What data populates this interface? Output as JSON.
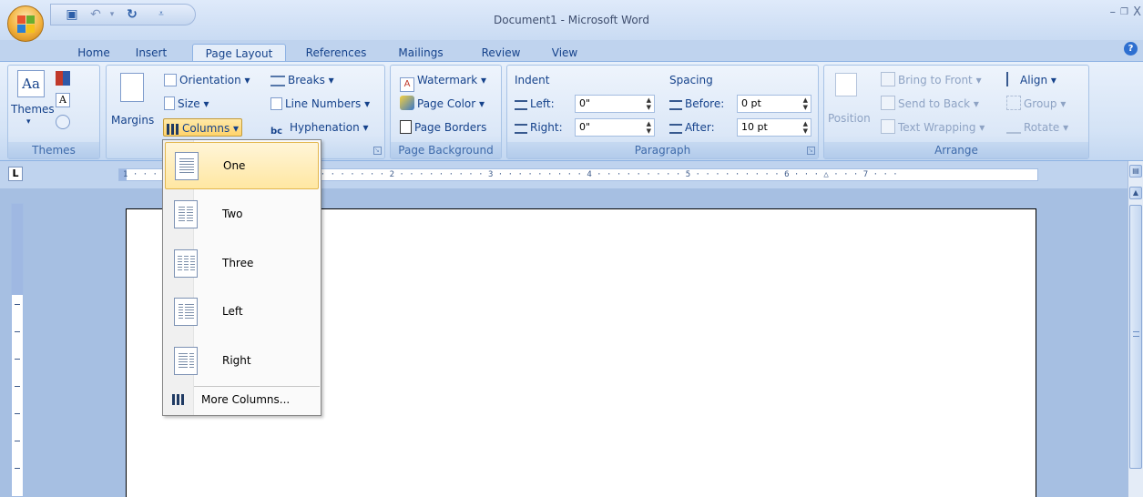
{
  "window": {
    "title": "Document1 - Microsoft Word",
    "controls": {
      "minimize": "–",
      "restore": "❐",
      "close": "X"
    }
  },
  "tabs": [
    {
      "label": "Home",
      "active": false
    },
    {
      "label": "Insert",
      "active": false
    },
    {
      "label": "Page Layout",
      "active": true
    },
    {
      "label": "References",
      "active": false
    },
    {
      "label": "Mailings",
      "active": false
    },
    {
      "label": "Review",
      "active": false
    },
    {
      "label": "View",
      "active": false
    }
  ],
  "ribbon": {
    "themes": {
      "group_label": "Themes",
      "themes_btn": "Themes"
    },
    "page_setup": {
      "margins": "Margins",
      "orientation": "Orientation ▾",
      "size": "Size ▾",
      "columns": "Columns ▾",
      "breaks": "Breaks ▾",
      "line_numbers": "Line Numbers ▾",
      "hyphenation": "Hyphenation ▾"
    },
    "page_background": {
      "group_label": "Page Background",
      "watermark": "Watermark ▾",
      "page_color": "Page Color ▾",
      "page_borders": "Page Borders"
    },
    "paragraph": {
      "group_label": "Paragraph",
      "indent_heading": "Indent",
      "spacing_heading": "Spacing",
      "left_label": "Left:",
      "left_value": "0\"",
      "right_label": "Right:",
      "right_value": "0\"",
      "before_label": "Before:",
      "before_value": "0 pt",
      "after_label": "After:",
      "after_value": "10 pt"
    },
    "arrange": {
      "group_label": "Arrange",
      "position": "Position",
      "bring_to_front": "Bring to Front ▾",
      "send_to_back": "Send to Back ▾",
      "text_wrapping": "Text Wrapping ▾",
      "align": "Align ▾",
      "group": "Group ▾",
      "rotate": "Rotate ▾"
    }
  },
  "ruler": {
    "ticks": "1 · · ·                         · 1 · · · · · · · · · 2 · · · · · · · · · 3 · · · · · · · · · 4 · · · · · · · · · 5 · · · · · · · · · 6 · · · △ · · · 7 · · ·"
  },
  "columns_menu": {
    "items": [
      {
        "label": "One",
        "highlighted": true
      },
      {
        "label": "Two",
        "highlighted": false
      },
      {
        "label": "Three",
        "highlighted": false
      },
      {
        "label": "Left",
        "highlighted": false
      },
      {
        "label": "Right",
        "highlighted": false
      }
    ],
    "more_columns": "More Columns..."
  },
  "colors": {
    "ribbon_text": "#15428b",
    "menu_highlight": "#ffe7a2",
    "workspace": "#a6bfe2"
  }
}
